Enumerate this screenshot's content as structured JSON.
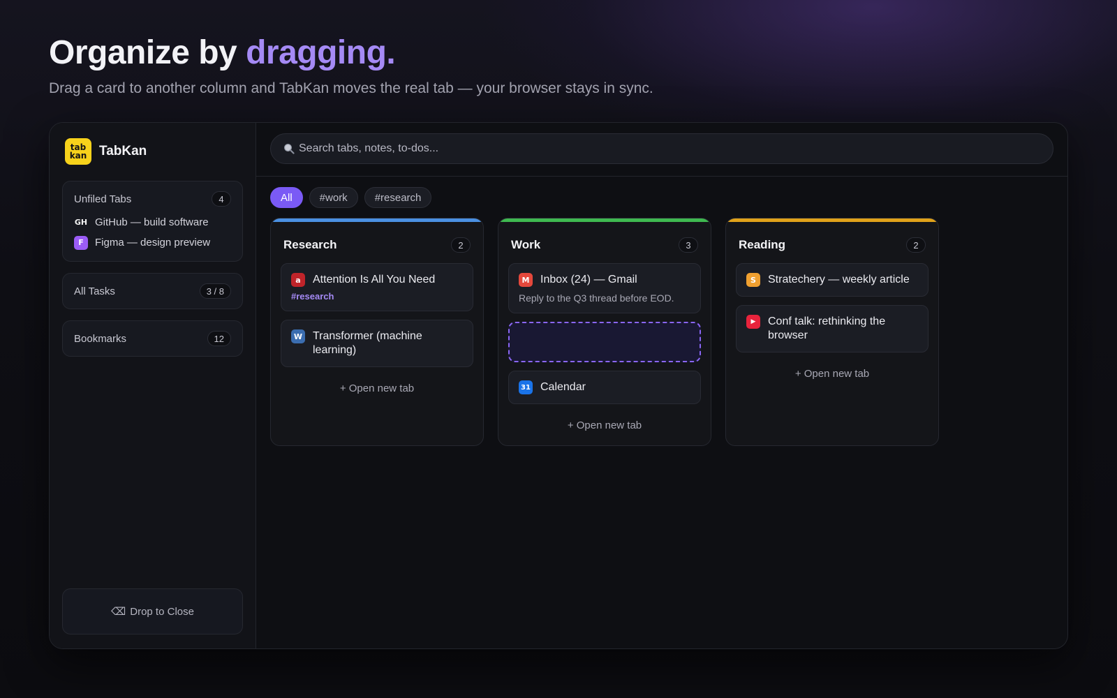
{
  "hero": {
    "title_main": "Organize by ",
    "title_accent": "dragging.",
    "subtitle": "Drag a card to another column and TabKan moves the real tab — your browser stays in sync."
  },
  "brand": {
    "name": "TabKan",
    "logo_line1": "tab",
    "logo_line2": "kan"
  },
  "sidebar": {
    "unfiled": {
      "label": "Unfiled Tabs",
      "count": "4",
      "items": [
        {
          "icon_text": "GH",
          "label": "GitHub — build software"
        },
        {
          "icon_text": "F",
          "label": "Figma — design preview"
        }
      ]
    },
    "tasks": {
      "label": "All Tasks",
      "count": "3 / 8"
    },
    "bookmarks": {
      "label": "Bookmarks",
      "count": "12"
    },
    "drop_close": {
      "icon": "⌫",
      "label": "Drop to Close"
    }
  },
  "search": {
    "placeholder": "Search tabs, notes, to-dos..."
  },
  "filters": [
    "All",
    "#work",
    "#research"
  ],
  "columns": [
    {
      "title": "Research",
      "count": "2",
      "color": "#4a90e2",
      "cards": [
        {
          "icon_text": "a",
          "icon_color": "#c0242a",
          "title": "Attention Is All You Need",
          "tag": "#research"
        },
        {
          "icon_text": "W",
          "icon_color": "#3b6db0",
          "title": "Transformer (machine learning)"
        }
      ],
      "open_new": "+ Open new tab"
    },
    {
      "title": "Work",
      "count": "3",
      "color": "#3fb950",
      "cards": [
        {
          "icon_text": "M",
          "icon_color": "#e5483c",
          "title": "Inbox (24) — Gmail",
          "note": "Reply to the Q3 thread before EOD."
        },
        {
          "icon_text": "31",
          "icon_color": "#1a73e8",
          "title": "Calendar"
        }
      ],
      "open_new": "+ Open new tab"
    },
    {
      "title": "Reading",
      "count": "2",
      "color": "#e0a21a",
      "cards": [
        {
          "icon_text": "S",
          "icon_color": "#f0a030",
          "title": "Stratechery — weekly article"
        },
        {
          "icon_text": "▶",
          "icon_color": "#e8233c",
          "title": "Conf talk: rethinking the browser"
        }
      ],
      "open_new": "+ Open new tab"
    }
  ]
}
